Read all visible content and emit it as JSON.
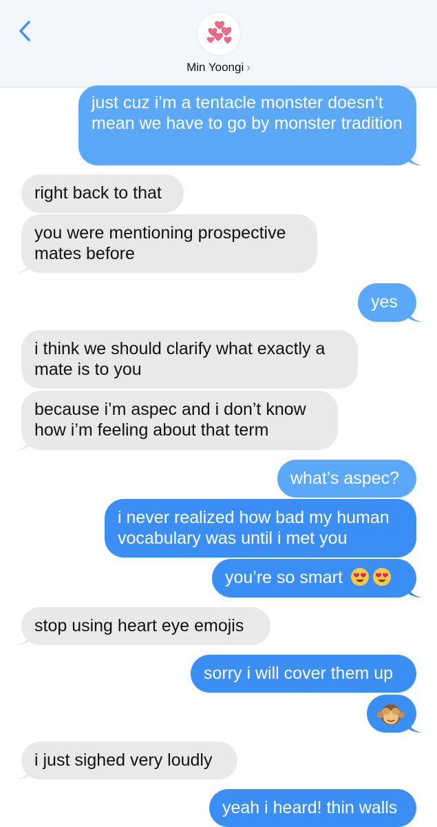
{
  "header": {
    "contact_name": "Min Yoongi",
    "chevron": "›",
    "back_icon": "chevron-left-icon",
    "avatar_icon": "hearts-icon",
    "accent": "#3b8ef3"
  },
  "messages": [
    {
      "side": "out",
      "text": "just cuz i’m a tentacle monster doesn’t mean we have to go by monster tradition"
    },
    {
      "side": "in",
      "text": "right back to that"
    },
    {
      "side": "in",
      "text": "you were mentioning prospective mates before"
    },
    {
      "side": "out",
      "text": "yes"
    },
    {
      "side": "in",
      "text": "i think we should clarify what exactly a mate is to you"
    },
    {
      "side": "in",
      "text": "because i’m aspec and i don’t know how i’m feeling about that term"
    },
    {
      "side": "out",
      "text": "what’s aspec?"
    },
    {
      "side": "out",
      "text": "i never realized how bad my human vocabulary was until i met you"
    },
    {
      "side": "out",
      "text": "you’re so smart",
      "emoji": [
        "heart-eyes-emoji",
        "heart-eyes-emoji"
      ]
    },
    {
      "side": "in",
      "text": "stop using heart eye emojis"
    },
    {
      "side": "out",
      "text": "sorry i will cover them up"
    },
    {
      "side": "out",
      "text": "",
      "emoji": [
        "see-no-evil-monkey-emoji"
      ]
    },
    {
      "side": "in",
      "text": "i just sighed very loudly"
    },
    {
      "side": "out",
      "text": "yeah i heard! thin walls"
    }
  ]
}
